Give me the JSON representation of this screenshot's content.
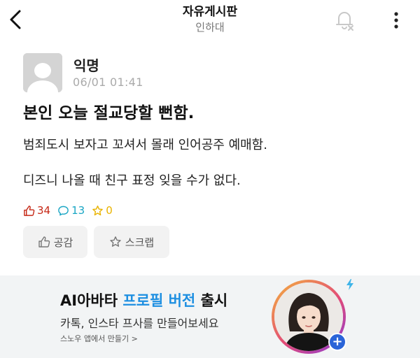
{
  "header": {
    "title": "자유게시판",
    "subtitle": "인하대"
  },
  "post": {
    "author": "익명",
    "date": "06/01 01:41",
    "title": "본인 오늘 절교당할 뻔함.",
    "body": [
      "범죄도시 보자고 꼬셔서 몰래 인어공주 예매함.",
      "디즈니 나올 때 친구 표정 잊을 수가 없다."
    ],
    "stats": {
      "likes": "34",
      "comments": "13",
      "scraps": "0"
    },
    "actions": {
      "like_label": "공감",
      "scrap_label": "스크랩"
    }
  },
  "banner": {
    "title_prefix": "AI아바타 ",
    "title_accent": "프로필 버전",
    "title_suffix": " 출시",
    "subtitle": "카톡, 인스타 프사를 만들어보세요",
    "link": "스노우 앱에서 만들기 >",
    "plus": "+"
  },
  "colors": {
    "like": "#c62917",
    "comment": "#1aa6c4",
    "scrap": "#e9b300",
    "accent": "#1e8fe1"
  }
}
